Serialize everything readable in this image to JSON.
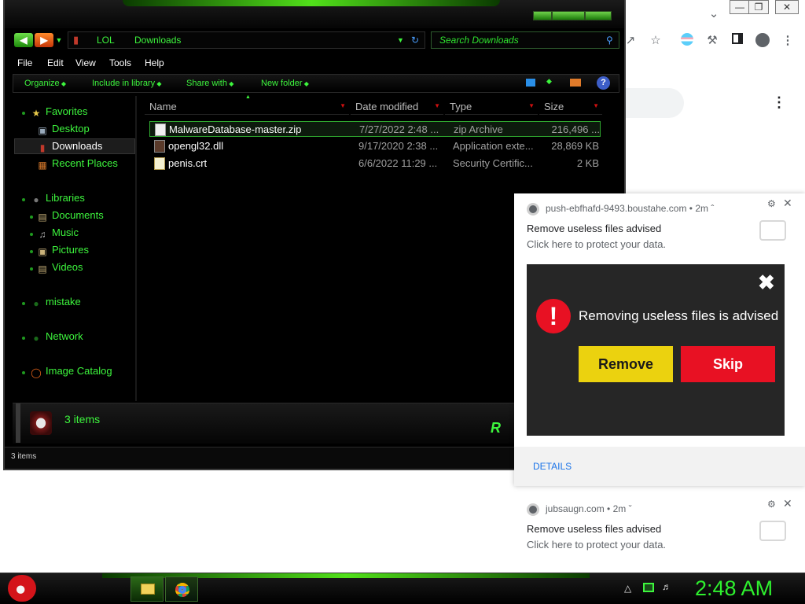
{
  "explorer": {
    "breadcrumb": [
      "LOL",
      "Downloads"
    ],
    "search_placeholder": "Search Downloads",
    "menu": [
      "File",
      "Edit",
      "View",
      "Tools",
      "Help"
    ],
    "commands": [
      "Organize",
      "Include in library",
      "Share with",
      "New folder"
    ],
    "nav": {
      "favorites_label": "Favorites",
      "favorites": [
        "Desktop",
        "Downloads",
        "Recent Places"
      ],
      "libraries_label": "Libraries",
      "libraries": [
        "Documents",
        "Music",
        "Pictures",
        "Videos"
      ],
      "mistake": "mistake",
      "network": "Network",
      "image_catalog": "Image Catalog"
    },
    "columns": [
      "Name",
      "Date modified",
      "Type",
      "Size"
    ],
    "files": [
      {
        "name": "MalwareDatabase-master.zip",
        "date": "7/27/2022 2:48 ...",
        "type": "zip Archive",
        "size": "216,496 ..."
      },
      {
        "name": "opengl32.dll",
        "date": "9/17/2020 2:38 ...",
        "type": "Application exte...",
        "size": "28,869 KB"
      },
      {
        "name": "penis.crt",
        "date": "6/6/2022 11:29 ...",
        "type": "Security Certific...",
        "size": "2 KB"
      }
    ],
    "details_count": "3 items",
    "status_count": "3 items"
  },
  "notifications": [
    {
      "source": "push-ebfhafd-9493.boustahe.com",
      "time": "2m",
      "title": "Remove useless files advised",
      "message": "Click here to protect your data.",
      "image": {
        "text": "Removing useless files is advised",
        "remove_label": "Remove",
        "skip_label": "Skip",
        "close_glyph": "✖",
        "warning_glyph": "!"
      },
      "details_label": "DETAILS"
    },
    {
      "source": "jubsaugn.com",
      "time": "2m",
      "title": "Remove useless files advised",
      "message": "Click here to protect your data."
    }
  ],
  "taskbar": {
    "clock": "2:48 AM"
  },
  "colors": {
    "accent_green": "#3df53d",
    "remove_button": "#ebd20f",
    "skip_button": "#e81123",
    "link_blue": "#1a73e8"
  }
}
